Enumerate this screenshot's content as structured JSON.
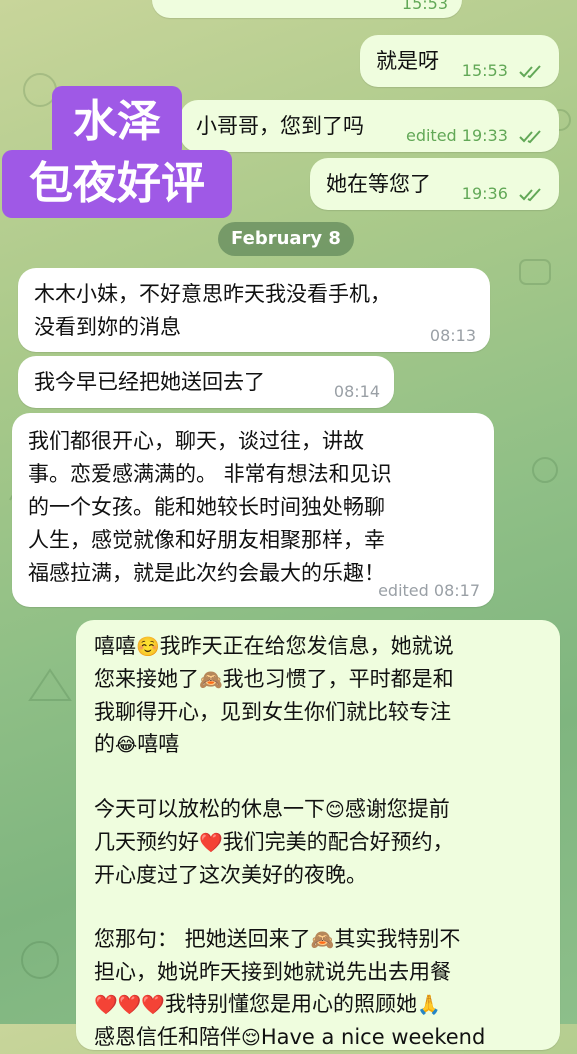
{
  "messages": {
    "top_partial_time": "15:53",
    "m1": {
      "text": "就是呀",
      "time": "15:53"
    },
    "m2": {
      "text": "小哥哥，您到了吗",
      "time": "edited 19:33"
    },
    "m3": {
      "text": "她在等您了",
      "time": "19:36"
    },
    "date_divider": "February 8",
    "m4": {
      "line1": "木木小妹，不好意思昨天我没看手机，",
      "line2": "没看到妳的消息",
      "time": "08:13"
    },
    "m5": {
      "text": "我今早已经把她送回去了",
      "time": "08:14"
    },
    "m6": {
      "lines": [
        "我们都很开心，聊天，谈过往，讲故",
        "事。恋爱感满满的。 非常有想法和见识",
        "的一个女孩。能和她较长时间独处畅聊",
        "人生，感觉就像和好朋友相聚那样，幸",
        "福感拉满，就是此次约会最大的乐趣！"
      ],
      "time": "edited 08:17"
    },
    "m7": {
      "p1_l1a": "嘻嘻",
      "p1_l1b": "我昨天正在给您发信息，她就说",
      "p1_l2a": "您来接她了",
      "p1_l2b": "我也习惯了，平时都是和",
      "p1_l3": "我聊得开心，见到女生你们就比较专注",
      "p1_l4a": "的",
      "p1_l4b": "嘻嘻",
      "p2_l1a": "今天可以放松的休息一下",
      "p2_l1b": "感谢您提前",
      "p2_l2a": "几天预约好",
      "p2_l2b": "我们完美的配合好预约，",
      "p2_l3": "开心度过了这次美好的夜晚。",
      "p3_l1a": "您那句： 把她送回来了",
      "p3_l1b": "其实我特别不",
      "p3_l2": "担心，她说昨天接到她就说先出去用餐",
      "p3_l3b": "我特别懂您是用心的照顾她",
      "p3_l4a": "感恩信任和陪伴",
      "p3_l4b": "Have a nice weekend"
    }
  },
  "emojis": {
    "smile_blush": "☺️",
    "monkey": "🙈",
    "laugh": "😂",
    "smile": "😊",
    "heart": "❤️",
    "pray": "🙏",
    "relieved": "😌"
  },
  "watermark": {
    "line1": "水泽",
    "line2": "包夜好评"
  },
  "colors": {
    "outgoing_bubble": "#effdde",
    "incoming_bubble": "#ffffff",
    "badge": "#9f59e6",
    "check": "#62a857"
  }
}
